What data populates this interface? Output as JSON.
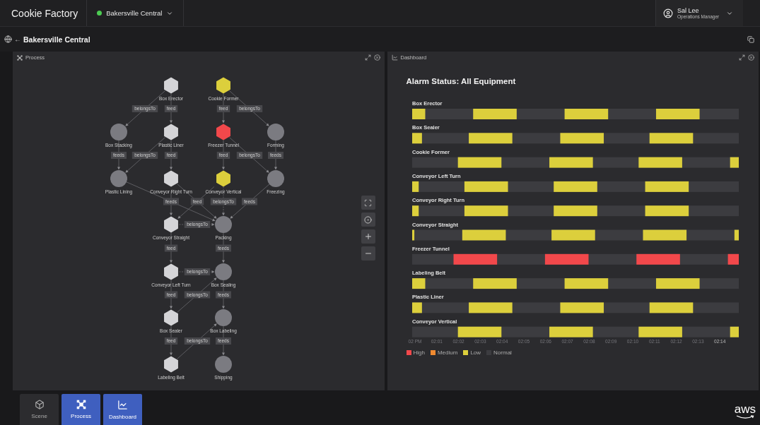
{
  "app": {
    "name": "Cookie Factory"
  },
  "site_selector": {
    "label": "Bakersville Central"
  },
  "user": {
    "name": "Sal Lee",
    "role": "Operations Manager"
  },
  "breadcrumb": {
    "back": "←",
    "title": "Bakersville Central"
  },
  "panels": [
    {
      "kind": "process",
      "title": "Process"
    },
    {
      "kind": "dashboard",
      "title": "Dashboard"
    }
  ],
  "process": {
    "nodes": [
      {
        "label": "Box Erector",
        "kind": "hexagon",
        "color": "#d4d4d7"
      },
      {
        "label": "Cookie Former",
        "kind": "hexagon",
        "color": "#dccf3c"
      },
      {
        "label": "Box Stacking",
        "kind": "circle",
        "color": "#7b7b81"
      },
      {
        "label": "Plastic Liner",
        "kind": "hexagon",
        "color": "#d4d4d7"
      },
      {
        "label": "Freezer Tunnel",
        "kind": "hexagon",
        "color": "#f2484b"
      },
      {
        "label": "Forming",
        "kind": "circle",
        "color": "#7b7b81"
      },
      {
        "label": "Plastic Lining",
        "kind": "circle",
        "color": "#7b7b81"
      },
      {
        "label": "Conveyor Right Turn",
        "kind": "hexagon",
        "color": "#d4d4d7"
      },
      {
        "label": "Conveyor Vertical",
        "kind": "hexagon",
        "color": "#dccf3c"
      },
      {
        "label": "Freezing",
        "kind": "circle",
        "color": "#7b7b81"
      },
      {
        "label": "Conveyor Straight",
        "kind": "hexagon",
        "color": "#d4d4d7"
      },
      {
        "label": "Packing",
        "kind": "circle",
        "color": "#7b7b81"
      },
      {
        "label": "Conveyor Left Turn",
        "kind": "hexagon",
        "color": "#d4d4d7"
      },
      {
        "label": "Box Sealing",
        "kind": "circle",
        "color": "#7b7b81"
      },
      {
        "label": "Box Sealer",
        "kind": "hexagon",
        "color": "#d4d4d7"
      },
      {
        "label": "Box Labeling",
        "kind": "circle",
        "color": "#7b7b81"
      },
      {
        "label": "Labeling Belt",
        "kind": "hexagon",
        "color": "#d4d4d7"
      },
      {
        "label": "Shipping",
        "kind": "circle",
        "color": "#7b7b81"
      }
    ],
    "edges": [
      {
        "label": "belongsTo",
        "dashed": false
      },
      {
        "label": "feed",
        "dashed": false
      },
      {
        "label": "feed",
        "dashed": false
      },
      {
        "label": "belongsTo",
        "dashed": false
      },
      {
        "label": "feeds",
        "dashed": false
      },
      {
        "label": "belongsTo",
        "dashed": false
      },
      {
        "label": "feed",
        "dashed": false
      },
      {
        "label": "feed",
        "dashed": false
      },
      {
        "label": "belongsTo",
        "dashed": false
      },
      {
        "label": "feeds",
        "dashed": false
      },
      {
        "label": "feeds",
        "dashed": false
      },
      {
        "dashed": false
      },
      {
        "label": "feed",
        "dashed": false
      },
      {
        "dashed": false
      },
      {
        "label": "belongsTo",
        "dashed": true
      },
      {
        "label": "feeds",
        "dashed": false
      },
      {
        "label": "belongsTo",
        "dashed": true
      },
      {
        "label": "feed",
        "dashed": false
      },
      {
        "label": "feeds",
        "dashed": false
      },
      {
        "label": "belongsTo",
        "dashed": true
      },
      {
        "label": "feed",
        "dashed": false
      },
      {
        "label": "belongsTo",
        "dashed": false
      },
      {
        "label": "feeds",
        "dashed": false
      },
      {
        "label": "feed",
        "dashed": false
      },
      {
        "label": "belongsTo",
        "dashed": false
      },
      {
        "label": "feeds",
        "dashed": false
      }
    ]
  },
  "dashboard": {
    "title": "Alarm Status: All Equipment",
    "rows": [
      {
        "label": "Box Erector",
        "color": "#dccf3c"
      },
      {
        "label": "Box Sealer",
        "color": "#dccf3c"
      },
      {
        "label": "Cookie Former",
        "color": "#dccf3c"
      },
      {
        "label": "Conveyor Left Turn",
        "color": "#dccf3c"
      },
      {
        "label": "Conveyor Right Turn",
        "color": "#dccf3c"
      },
      {
        "label": "Conveyor Straight",
        "color": "#dccf3c"
      },
      {
        "label": "Freezer Tunnel",
        "color": "#f2484b"
      },
      {
        "label": "Labeling Belt",
        "color": "#dccf3c"
      },
      {
        "label": "Plastic Liner",
        "color": "#dccf3c"
      },
      {
        "label": "Conveyor Vertical",
        "color": "#dccf3c"
      }
    ],
    "time_labels": [
      "02 PM",
      "02:01",
      "02:02",
      "02:03",
      "02:04",
      "02:05",
      "02:06",
      "02:07",
      "02:08",
      "02:09",
      "02:10",
      "02:11",
      "02:12",
      "02:13",
      "02:14"
    ],
    "legend": [
      {
        "label": "High",
        "color": "#f2484b"
      },
      {
        "label": "Medium",
        "color": "#f08a30"
      },
      {
        "label": "Low",
        "color": "#dccf3c"
      },
      {
        "label": "Normal",
        "color": "#3c3c40"
      }
    ]
  },
  "nav": [
    {
      "kind": "scene",
      "label": "Scene",
      "selected": false
    },
    {
      "kind": "process",
      "label": "Process",
      "selected": true
    },
    {
      "kind": "dashboard",
      "label": "Dashboard",
      "selected": true
    }
  ],
  "footer_logo": {
    "text": "aws"
  }
}
